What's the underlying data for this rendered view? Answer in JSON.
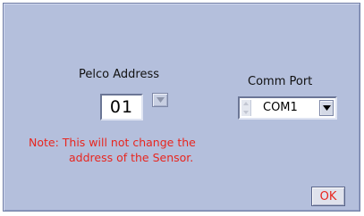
{
  "pelco": {
    "label": "Pelco Address",
    "value": "01",
    "stepper_icon": "triangle-down"
  },
  "comm_port": {
    "label": "Comm Port",
    "value": "COM1",
    "dropdown_icon": "triangle-down"
  },
  "note": {
    "line1": "Note:  This will not change the",
    "line2": "address of the Sensor."
  },
  "ok_button": {
    "label": "OK"
  },
  "colors": {
    "panel": "#b4bfdc",
    "note_text": "#e8261f",
    "ok_text": "#e8261f"
  }
}
